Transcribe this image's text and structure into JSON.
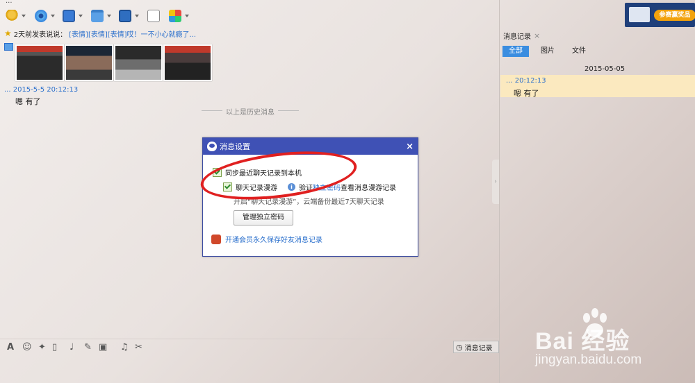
{
  "top": {
    "ellipsis": "..."
  },
  "status": {
    "prefix": "2天前发表说说：",
    "link": "[表情][表情][表情]哎！一不小心就瘾了..."
  },
  "message": {
    "time": "... 2015-5-5  20:12:13",
    "text": "嗯  有了"
  },
  "history_separator": "以上是历史消息",
  "dialog": {
    "title": "消息设置",
    "close": "×",
    "sync_label": "同步最近聊天记录到本机",
    "roam_label": "聊天记录漫游",
    "verify_prefix": "验证",
    "verify_link": "独立密码",
    "verify_suffix": "查看消息漫游记录",
    "roam_desc": "开启“聊天记录漫游”，云端备份最近7天聊天记录",
    "manage_button": "管理独立密码",
    "vip_link": "开通会员永久保存好友消息记录"
  },
  "bottom": {
    "history_button": "消息记录"
  },
  "right_panel": {
    "title": "消息记录",
    "close": "×",
    "tabs": [
      "全部",
      "图片",
      "文件"
    ],
    "date": "2015-05-05",
    "entry_time": "... 20:12:13",
    "entry_text": "嗯  有了",
    "ad_text": "参赛赢奖品"
  },
  "watermark": {
    "brand": "Bai  经验",
    "url": "jingyan.baidu.com"
  },
  "colors": {
    "dialog_header": "#3f51b5",
    "link": "#2a6fcc",
    "annotation": "#e02020",
    "tab_active": "#3a8de0",
    "highlight": "#fbe9bf"
  }
}
